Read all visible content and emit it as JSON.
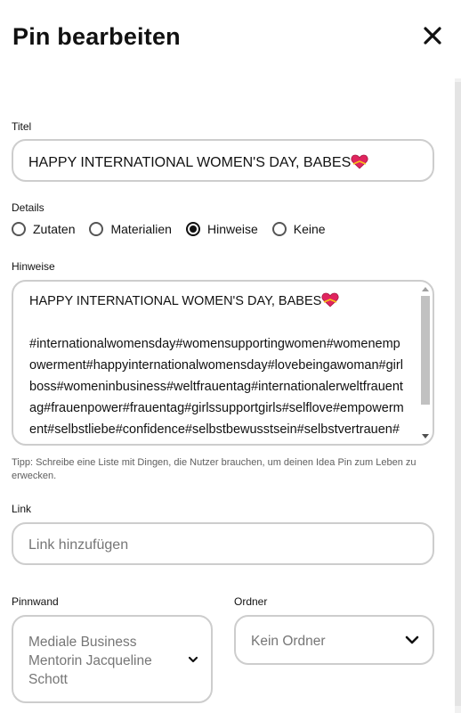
{
  "header": {
    "title": "Pin bearbeiten",
    "close_icon": "close-icon"
  },
  "title_field": {
    "label": "Titel",
    "value": "HAPPY INTERNATIONAL WOMEN'S DAY, BABES",
    "emoji": "heart-with-ribbon"
  },
  "details": {
    "label": "Details",
    "options": [
      {
        "label": "Zutaten",
        "checked": false
      },
      {
        "label": "Materialien",
        "checked": false
      },
      {
        "label": "Hinweise",
        "checked": true
      },
      {
        "label": "Keine",
        "checked": false
      }
    ]
  },
  "hints_field": {
    "label": "Hinweise",
    "line1": "HAPPY INTERNATIONAL WOMEN'S DAY, BABES",
    "hashtags": "#internationalwomensday#womensupportingwomen#womenempowerment#happyinternationalwomensday#lovebeingawoman#girlboss#womeninbusiness#weltfrauentag#internationalerweltfrauentag#frauenpower#frauentag#girlssupportgirls#selflove#empowerment#selbstliebe#confidence#selbstbewusstsein#selbstvertrauen#mindset#frauenkraft"
  },
  "tip": "Tipp: Schreibe eine Liste mit Dingen, die Nutzer brauchen, um deinen Idea Pin zum Leben zu erwecken.",
  "link_field": {
    "label": "Link",
    "placeholder": "Link hinzufügen"
  },
  "board_field": {
    "label": "Pinnwand",
    "value": "Mediale Business Mentorin Jacqueline Schott"
  },
  "folder_field": {
    "label": "Ordner",
    "value": "Kein Ordner"
  }
}
